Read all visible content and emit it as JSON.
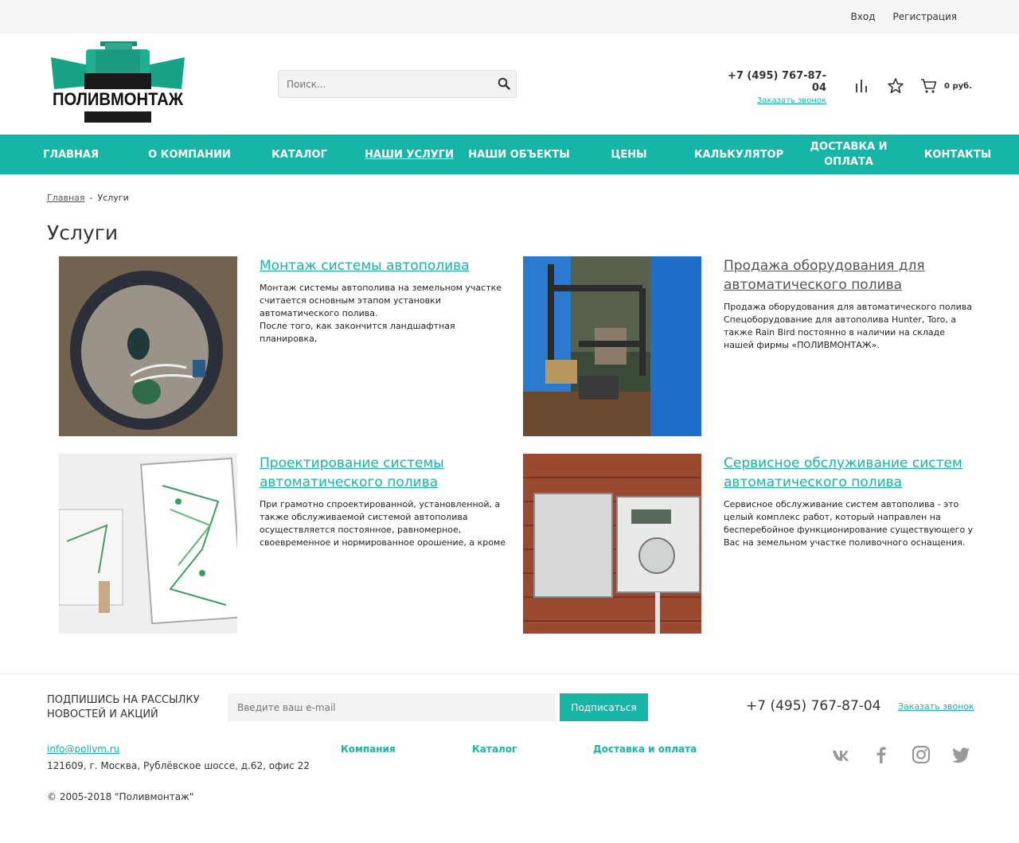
{
  "topbar": {
    "login": "Вход",
    "register": "Регистрация"
  },
  "header": {
    "logo_text": "ПОЛИВМОНТАЖ",
    "search_placeholder": "Поиск...",
    "phone": "+7 (495) 767-87-04",
    "callback": "Заказать звонок",
    "cart_sum": "0 руб."
  },
  "nav": [
    "Главная",
    "О компании",
    "Каталог",
    "Наши услуги",
    "Наши объекты",
    "Цены",
    "Калькулятор",
    "Доставка и оплата",
    "Контакты"
  ],
  "breadcrumb": {
    "home": "Главная",
    "sep": "-",
    "current": "Услуги"
  },
  "page_title": "Услуги",
  "services": [
    {
      "title": "Монтаж системы автополива",
      "desc": "Монтаж системы автополива на земельном участке считается основным этапом установки автоматического полива.\nПосле того, как закончится ландшафтная планировка,"
    },
    {
      "title": "Продажа оборудования для автоматического полива",
      "desc": "Продажа оборудования для автоматического полива Спецоборудование для автополива Hunter, Toro, а также Rain Bird постоянно в наличии на складе нашей фирмы «ПОЛИВМОНТАЖ»."
    },
    {
      "title": "Проектирование системы автоматического полива",
      "desc": "При грамотно спроектированной, установленной, а также обслуживаемой системой автополива осуществляется постоянное, равномерное, своевременное и нормированное орошение, а кроме"
    },
    {
      "title": "Сервисное обслуживание систем автоматического полива",
      "desc": "Сервисное обслуживание систем автополива - это целый комплекс работ, который направлен на бесперебойное функционирование существующего у Вас на земельном участке поливочного оснащения."
    }
  ],
  "footer": {
    "subscribe_label": "Подпишись на рассылку новостей и акций",
    "email_placeholder": "Введите ваш e-mail",
    "subscribe_btn": "Подписаться",
    "phone": "+7 (495) 767-87-04",
    "callback": "Заказать звонок",
    "email": "info@polivm.ru",
    "address": "121609, г. Москва, Рублёвское шоссе, д.62, офис 22",
    "links": [
      "Компания",
      "Каталог",
      "Доставка и оплата"
    ],
    "copyright": "© 2005-2018 \"Поливмонтаж\""
  },
  "colors": {
    "accent": "#17b5a6",
    "topbar_bg": "#f5f5f5"
  }
}
